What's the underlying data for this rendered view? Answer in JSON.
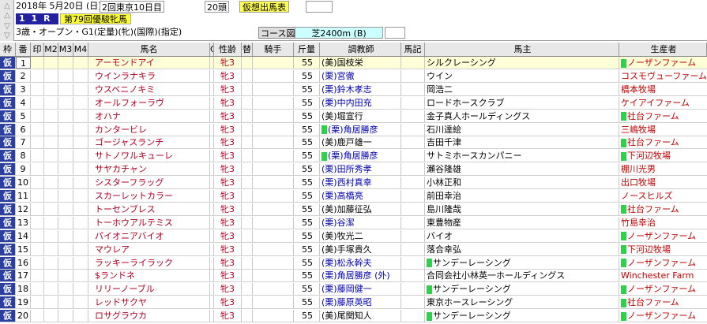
{
  "header": {
    "date": "2018年  5月20日 (日)",
    "meeting": "2回東京10日目",
    "field_size": "20頭",
    "mode_label": "仮想出馬表",
    "race_no": "1 1 R",
    "race_name": "第79回優駿牝馬",
    "conditions": "3歳・オープン・G1(定量)(牝)(国際)(指定)",
    "course_label": "コース図",
    "course": "芝2400m (B)"
  },
  "nav": {
    "up_icon": "up-arrow-icon",
    "down_icon": "down-arrow-icon"
  },
  "table": {
    "headers": {
      "waku": "枠",
      "umaban": "番",
      "mark1": "印",
      "mark2": "M2",
      "mark3": "M3",
      "mark4": "M4",
      "name": "馬名",
      "c": "C",
      "sex_age": "性齢",
      "swap": "替",
      "jockey": "騎手",
      "weight": "斤量",
      "trainer": "調教師",
      "memo": "馬記",
      "owner": "馬主",
      "breeder": "生産者"
    },
    "rows": [
      {
        "waku": "仮",
        "num": "1",
        "name": "アーモンドアイ",
        "sex": "牝3",
        "weight": "55",
        "trainer": "(美)国枝栄",
        "ritto": false,
        "owner_mark": false,
        "owner": "シルクレーシング",
        "breeder_mark": true,
        "breeder": "ノーザンファーム"
      },
      {
        "waku": "仮",
        "num": "2",
        "name": "ウインラナキラ",
        "sex": "牝3",
        "weight": "55",
        "trainer": "(栗)宮徹",
        "ritto": true,
        "owner_mark": false,
        "owner": "ウイン",
        "breeder_mark": false,
        "breeder": "コスモヴューファーム"
      },
      {
        "waku": "仮",
        "num": "3",
        "name": "ウスベニノキミ",
        "sex": "牝3",
        "weight": "55",
        "trainer": "(栗)鈴木孝志",
        "ritto": true,
        "owner_mark": false,
        "owner": "岡浩二",
        "breeder_mark": false,
        "breeder": "橋本牧場"
      },
      {
        "waku": "仮",
        "num": "4",
        "name": "オールフォーラヴ",
        "sex": "牝3",
        "weight": "55",
        "trainer": "(栗)中内田充",
        "ritto": true,
        "owner_mark": false,
        "owner": "ロードホースクラブ",
        "breeder_mark": false,
        "breeder": "ケイアイファーム"
      },
      {
        "waku": "仮",
        "num": "5",
        "name": "オハナ",
        "sex": "牝3",
        "weight": "55",
        "trainer": "(美)堀宣行",
        "ritto": false,
        "owner_mark": false,
        "owner": "金子真人ホールディングス",
        "breeder_mark": true,
        "breeder": "社台ファーム"
      },
      {
        "waku": "仮",
        "num": "6",
        "name": "カンタービレ",
        "sex": "牝3",
        "weight": "55",
        "trainer": "(栗)角居勝彦",
        "ritto": true,
        "owner_mark": false,
        "owner": "石川達絵",
        "breeder_mark": false,
        "breeder": "三嶋牧場",
        "trainer_mark": true
      },
      {
        "waku": "仮",
        "num": "7",
        "name": "ゴージャスランチ",
        "sex": "牝3",
        "weight": "55",
        "trainer": "(美)鹿戸雄一",
        "ritto": false,
        "owner_mark": false,
        "owner": "吉田千津",
        "breeder_mark": true,
        "breeder": "社台ファーム"
      },
      {
        "waku": "仮",
        "num": "8",
        "name": "サトノワルキューレ",
        "sex": "牝3",
        "weight": "55",
        "trainer": "(栗)角居勝彦",
        "ritto": true,
        "owner_mark": false,
        "owner": "サトミホースカンパニー",
        "breeder_mark": true,
        "breeder": "下河辺牧場",
        "trainer_mark": true
      },
      {
        "waku": "仮",
        "num": "9",
        "name": "サヤカチャン",
        "sex": "牝3",
        "weight": "55",
        "trainer": "(栗)田所秀孝",
        "ritto": true,
        "owner_mark": false,
        "owner": "瀬谷隆雄",
        "breeder_mark": false,
        "breeder": "棚川光男"
      },
      {
        "waku": "仮",
        "num": "10",
        "name": "シスターフラッグ",
        "sex": "牝3",
        "weight": "55",
        "trainer": "(栗)西村真幸",
        "ritto": true,
        "owner_mark": false,
        "owner": "小林正和",
        "breeder_mark": false,
        "breeder": "出口牧場"
      },
      {
        "waku": "仮",
        "num": "11",
        "name": "スカーレットカラー",
        "sex": "牝3",
        "weight": "55",
        "trainer": "(栗)高橋亮",
        "ritto": true,
        "owner_mark": false,
        "owner": "前田幸治",
        "breeder_mark": false,
        "breeder": "ノースヒルズ"
      },
      {
        "waku": "仮",
        "num": "12",
        "name": "トーセンブレス",
        "sex": "牝3",
        "weight": "55",
        "trainer": "(美)加藤征弘",
        "ritto": false,
        "owner_mark": false,
        "owner": "島川隆哉",
        "breeder_mark": true,
        "breeder": "社台ファーム"
      },
      {
        "waku": "仮",
        "num": "13",
        "name": "トーホウアルテミス",
        "sex": "牝3",
        "weight": "55",
        "trainer": "(栗)谷潔",
        "ritto": true,
        "owner_mark": false,
        "owner": "東豊物産",
        "breeder_mark": false,
        "breeder": "竹島幸治"
      },
      {
        "waku": "仮",
        "num": "14",
        "name": "パイオニアバイオ",
        "sex": "牝3",
        "weight": "55",
        "trainer": "(美)牧光二",
        "ritto": false,
        "owner_mark": false,
        "owner": "バイオ",
        "breeder_mark": true,
        "breeder": "ノーザンファーム"
      },
      {
        "waku": "仮",
        "num": "15",
        "name": "マウレア",
        "sex": "牝3",
        "weight": "55",
        "trainer": "(美)手塚貴久",
        "ritto": false,
        "owner_mark": false,
        "owner": "落合幸弘",
        "breeder_mark": true,
        "breeder": "下河辺牧場"
      },
      {
        "waku": "仮",
        "num": "16",
        "name": "ラッキーライラック",
        "sex": "牝3",
        "weight": "55",
        "trainer": "(栗)松永幹夫",
        "ritto": true,
        "owner_mark": true,
        "owner": "サンデーレーシング",
        "breeder_mark": true,
        "breeder": "ノーザンファーム"
      },
      {
        "waku": "仮",
        "num": "17",
        "name": "$ランドネ",
        "sex": "牝3",
        "weight": "55",
        "trainer": "(栗)角居勝彦 (外)",
        "ritto": true,
        "owner_mark": false,
        "owner": "合同会社小林英一ホールディングス",
        "breeder_mark": false,
        "breeder": "Winchester Farm"
      },
      {
        "waku": "仮",
        "num": "18",
        "name": "リリーノーブル",
        "sex": "牝3",
        "weight": "55",
        "trainer": "(栗)藤岡健一",
        "ritto": true,
        "owner_mark": true,
        "owner": "サンデーレーシング",
        "breeder_mark": true,
        "breeder": "ノーザンファーム"
      },
      {
        "waku": "仮",
        "num": "19",
        "name": "レッドサクヤ",
        "sex": "牝3",
        "weight": "55",
        "trainer": "(栗)藤原英昭",
        "ritto": true,
        "owner_mark": false,
        "owner": "東京ホースレーシング",
        "breeder_mark": true,
        "breeder": "社台ファーム"
      },
      {
        "waku": "仮",
        "num": "20",
        "name": "ロサグラウカ",
        "sex": "牝3",
        "weight": "55",
        "trainer": "(美)尾関知人",
        "ritto": false,
        "owner_mark": true,
        "owner": "サンデーレーシング",
        "breeder_mark": true,
        "breeder": "ノーザンファーム"
      }
    ]
  },
  "colors": {
    "waku_bg": "#2a3fa0",
    "horse_name": "#b00020",
    "ritto_trainer": "#0000b0",
    "mark_green": "#2fd04a",
    "race_name_bg": "#ffff33"
  }
}
